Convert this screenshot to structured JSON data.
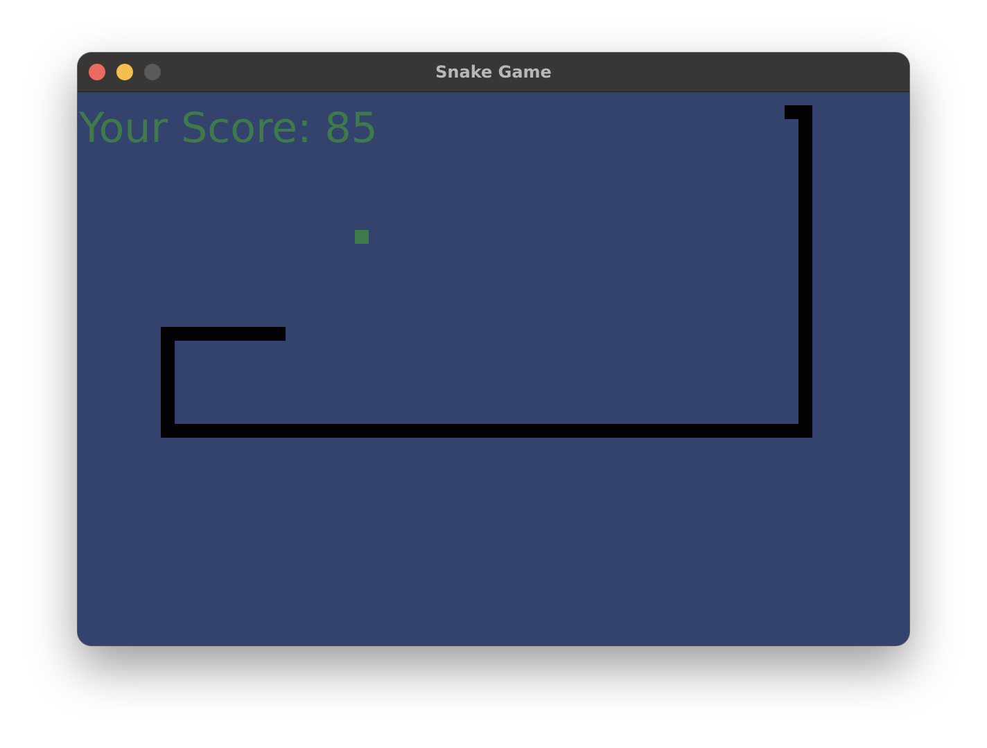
{
  "window": {
    "title": "Snake Game"
  },
  "game": {
    "score_text": "Your Score: 85",
    "score": 85,
    "colors": {
      "background": "#33436e",
      "snake": "#030304",
      "food": "#3f7a4b",
      "score_text": "#3f7a4b"
    }
  }
}
